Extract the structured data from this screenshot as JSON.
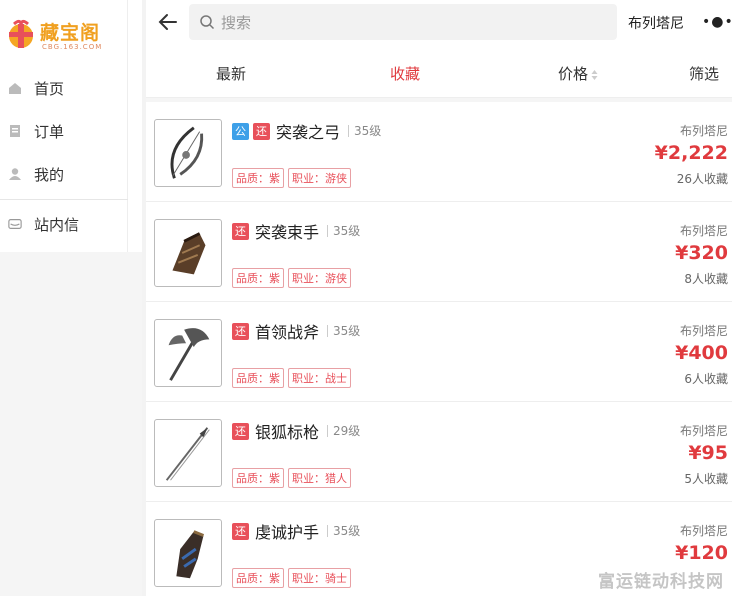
{
  "logo": {
    "text": "藏宝阁",
    "sub": "CBG.163.COM"
  },
  "sidebar": {
    "items": [
      {
        "label": "首页",
        "icon": "home-icon"
      },
      {
        "label": "订单",
        "icon": "order-icon"
      },
      {
        "label": "我的",
        "icon": "user-icon"
      },
      {
        "label": "站内信",
        "icon": "mail-icon"
      }
    ]
  },
  "topbar": {
    "search_placeholder": "搜索",
    "server": "布列塔尼",
    "more": "•●•"
  },
  "tabs": [
    {
      "label": "最新"
    },
    {
      "label": "收藏"
    },
    {
      "label": "价格"
    },
    {
      "label": "筛选"
    }
  ],
  "items": [
    {
      "name": "突袭之弓",
      "level": "35级",
      "tags": [
        "公",
        "还"
      ],
      "quality": "品质：紫",
      "job": "职业：游侠",
      "server": "布列塔尼",
      "price": "¥2,222",
      "fav": "26人收藏",
      "icon": "bow-icon"
    },
    {
      "name": "突袭束手",
      "level": "35级",
      "tags": [
        "还"
      ],
      "quality": "品质：紫",
      "job": "职业：游侠",
      "server": "布列塔尼",
      "price": "¥320",
      "fav": "8人收藏",
      "icon": "bracer-icon"
    },
    {
      "name": "首领战斧",
      "level": "35级",
      "tags": [
        "还"
      ],
      "quality": "品质：紫",
      "job": "职业：战士",
      "server": "布列塔尼",
      "price": "¥400",
      "fav": "6人收藏",
      "icon": "axe-icon"
    },
    {
      "name": "银狐标枪",
      "level": "29级",
      "tags": [
        "还"
      ],
      "quality": "品质：紫",
      "job": "职业：猎人",
      "server": "布列塔尼",
      "price": "¥95",
      "fav": "5人收藏",
      "icon": "spear-icon"
    },
    {
      "name": "虔诚护手",
      "level": "35级",
      "tags": [
        "还"
      ],
      "quality": "品质：紫",
      "job": "职业：骑士",
      "server": "布列塔尼",
      "price": "¥120",
      "fav": "",
      "icon": "gauntlet-icon"
    }
  ],
  "watermark": "富运链动科技网",
  "colors": {
    "accent": "#e03a3e",
    "tag_public": "#3ea0e8",
    "tag_return": "#e8505a"
  }
}
